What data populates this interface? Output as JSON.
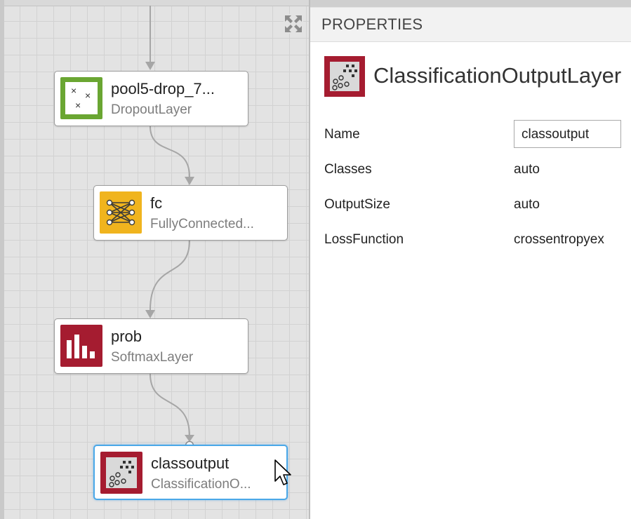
{
  "canvas": {
    "nodes": [
      {
        "name": "pool5-drop_7...",
        "type": "DropoutLayer",
        "icon": "dropout-icon",
        "color": "#6aa632"
      },
      {
        "name": "fc",
        "type": "FullyConnected...",
        "icon": "fully-connected-icon",
        "color": "#f0b41e"
      },
      {
        "name": "prob",
        "type": "SoftmaxLayer",
        "icon": "softmax-icon",
        "color": "#a51c30"
      },
      {
        "name": "classoutput",
        "type": "ClassificationO...",
        "icon": "classification-output-icon",
        "color": "#a51c30",
        "selected": true
      }
    ]
  },
  "properties": {
    "header": "PROPERTIES",
    "layer_title": "ClassificationOutputLayer",
    "layer_icon": "classification-output-icon",
    "fields": [
      {
        "label": "Name",
        "value": "classoutput",
        "editable": true
      },
      {
        "label": "Classes",
        "value": "auto"
      },
      {
        "label": "OutputSize",
        "value": "auto"
      },
      {
        "label": "LossFunction",
        "value": "crossentropyex"
      }
    ]
  },
  "colors": {
    "selection": "#4aa8e8",
    "output_layer": "#a51c30",
    "dropout_layer": "#6aa632",
    "fc_layer": "#f0b41e"
  }
}
